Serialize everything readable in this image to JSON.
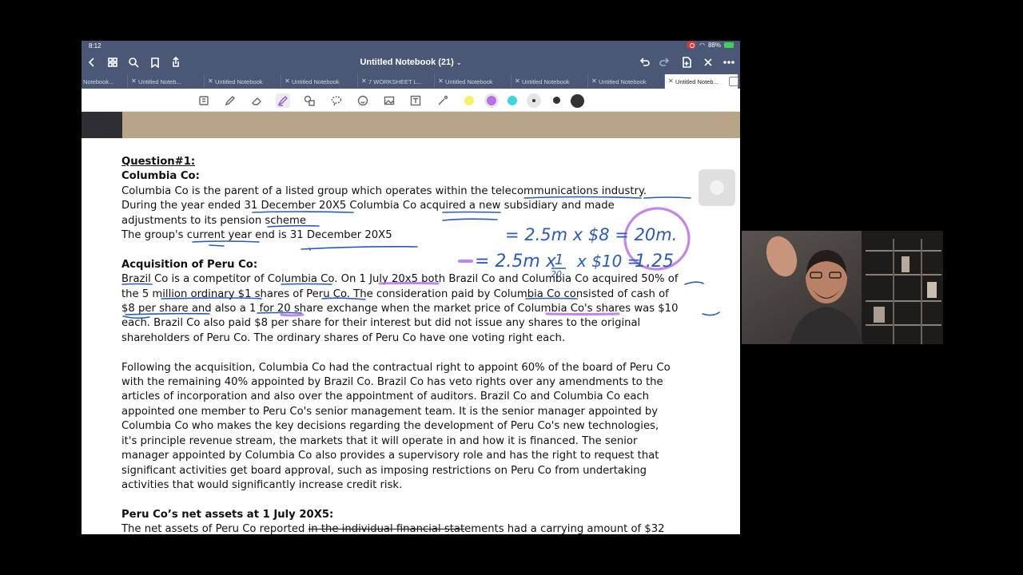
{
  "status": {
    "time": "8:12",
    "battery": "88%"
  },
  "nav": {
    "title": "Untitled Notebook (21)",
    "caret": "⌄"
  },
  "tabs": [
    {
      "label": "Notebook..."
    },
    {
      "label": "Untitled Noteb..."
    },
    {
      "label": "Untitled Notebook"
    },
    {
      "label": "Untitled Notebook"
    },
    {
      "label": "7 WORKSHEET  L..."
    },
    {
      "label": "Untitled Notebook"
    },
    {
      "label": "Untitled Notebook"
    },
    {
      "label": "Untitled Notebook"
    },
    {
      "label": "Untitled Noteb..."
    }
  ],
  "toolbar": {
    "icons": [
      "page-icon",
      "pen-icon",
      "eraser-icon",
      "highlighter-icon",
      "shapes-icon",
      "lasso-icon",
      "sticker-icon",
      "image-icon",
      "text-icon",
      "laser-pointer-icon"
    ],
    "colors": [
      "#f5f26a",
      "#b970e8",
      "#3ed4e0"
    ]
  },
  "document": {
    "q_heading": "Question#1:",
    "company_heading": "Columbia Co:",
    "p1": [
      "Columbia Co is the parent of a listed group which operates within the telecommunications industry.",
      "During the year ended 31 December 20X5 Columbia Co acquired a new subsidiary and made",
      "adjustments to its pension scheme",
      "The group's current year end is 31 December 20X5"
    ],
    "acq_heading": "Acquisition of Peru Co:",
    "p2": [
      "Brazil Co is a competitor of Columbia Co. On 1 July 20x5 both Brazil Co and Columbia Co acquired 50% of",
      "the 5 million ordinary $1 shares of Peru Co. The consideration paid by Columbia Co consisted of cash of",
      "$8 per share and also a 1 for 20 share exchange when the market price of Columbia Co's shares was $10",
      "each. Brazil Co also paid $8 per share for their interest but did not issue any shares to the original",
      "shareholders of Peru Co. The ordinary shares of Peru Co have one voting right each."
    ],
    "p3": [
      "Following the acquisition, Columbia Co had the contractual right to appoint 60% of the board of Peru Co",
      "with the remaining 40% appointed by Brazil Co. Brazil Co has veto rights over any amendments to the",
      "articles of incorporation and also over the appointment of auditors. Brazil Co and Columbia Co each",
      "appointed one member to Peru Co's senior management team. It is the senior manager appointed by",
      "Columbia Co who makes the key decisions regarding the development of Peru Co's new technologies,",
      "it's principle revenue stream, the markets that it will operate in and how it is financed. The senior",
      "manager appointed by Columbia Co also provides a supervisory role and has the right to request that",
      "significant activities get board approval, such as imposing restrictions on Peru Co from undertaking",
      "activities that would significantly increase credit risk."
    ],
    "net_heading": "Peru Co’s net assets at 1 July 20X5:",
    "last_line": {
      "before": "The net assets of Peru Co reported ",
      "struck": "in the individual financial stat",
      "after": "ements had a carrying amount of $32"
    }
  },
  "handwriting": {
    "line1": "= 2.5m x $8  =  20m.",
    "line2_a": "= 2.5m x",
    "line2_num": "1",
    "line2_den": "20",
    "line2_b": "x $10 =",
    "line2_result": "1.25"
  }
}
